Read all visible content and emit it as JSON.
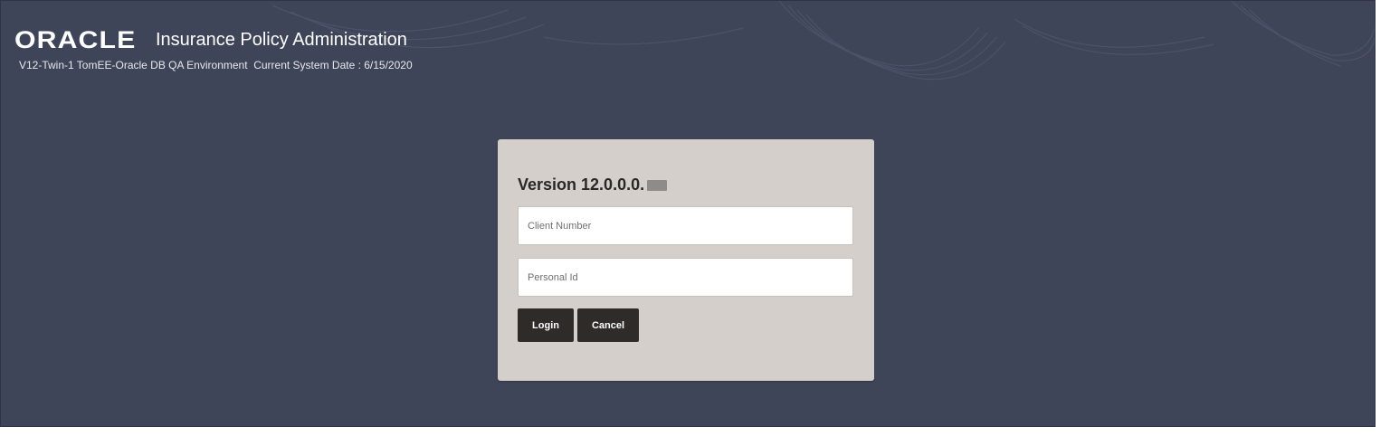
{
  "header": {
    "logo_text": "ORACLE",
    "app_title": "Insurance Policy Administration",
    "environment": "V12-Twin-1 TomEE-Oracle DB QA Environment  Current System Date : 6/15/2020"
  },
  "login": {
    "version_label": "Version 12.0.0.0.",
    "client_number_placeholder": "Client Number",
    "client_number_value": "",
    "personal_id_placeholder": "Personal Id",
    "personal_id_value": "",
    "login_label": "Login",
    "cancel_label": "Cancel"
  },
  "colors": {
    "background": "#3f4559",
    "card": "#d4cfcb",
    "button": "#2f2b28"
  }
}
